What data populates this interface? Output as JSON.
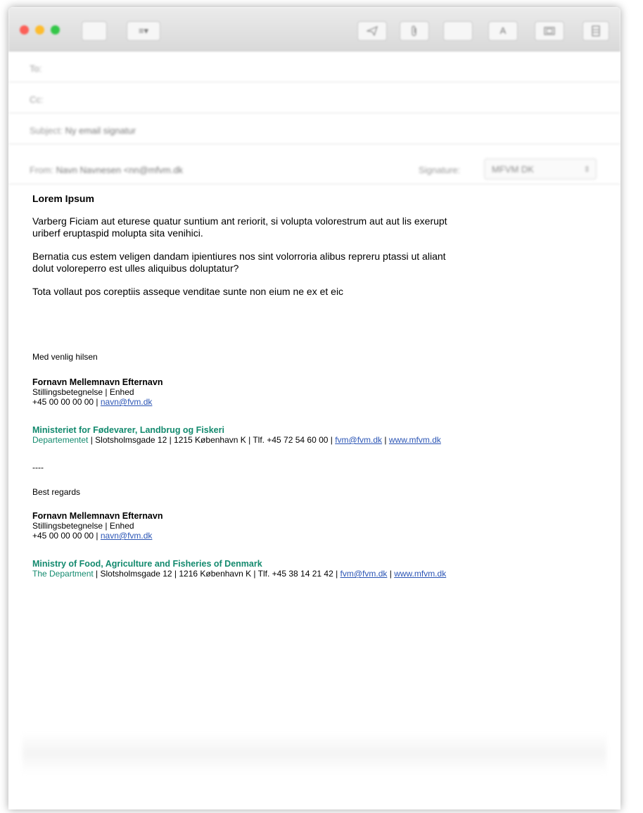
{
  "titlebar": {
    "format_button_label": "≡▾",
    "send_icon": "paper-plane-icon",
    "attach_icon": "paperclip-icon",
    "font_button_label": "A",
    "photo_icon": "photo-browser-icon",
    "sidebar_icon": "sidebar-icon"
  },
  "header": {
    "to_label": "To:",
    "cc_label": "Cc:",
    "subject_label": "Subject:",
    "subject_value": "Ny email signatur",
    "from_label": "From:",
    "from_value": "Navn Navnesen <nn@mfvm.dk",
    "signature_label": "Signature:",
    "signature_value": "MFVM DK"
  },
  "body": {
    "heading": "Lorem Ipsum",
    "paragraphs": [
      "Varberg Ficiam aut eturese quatur suntium ant reriorit, si volupta volorestrum aut aut lis exerupt uriberf eruptaspid molupta sita venihici.",
      "Bernatia cus estem veligen dandam ipientiures nos sint volorroria alibus repreru ptassi ut aliant dolut voloreperro est ulles aliquibus doluptatur?",
      "Tota vollaut pos coreptiis asseque venditae sunte non eium ne ex et eic"
    ]
  },
  "signature_da": {
    "greeting": "Med venlig hilsen",
    "name": "Fornavn Mellemnavn Efternavn",
    "title": "Stillingsbetegnelse | Enhed",
    "phone": "+45 00 00 00 00 | ",
    "email": "navn@fvm.dk",
    "org": "Ministeriet for Fødevarer, Landbrug og Fiskeri",
    "dept": "Departementet",
    "address": " | Slotsholmsgade 12 | 1215 København K | Tlf. +45 72 54 60 00 | ",
    "org_email": "fvm@fvm.dk",
    "sep": " | ",
    "web": "www.mfvm.dk"
  },
  "divider": "----",
  "signature_en": {
    "greeting": "Best regards",
    "name": "Fornavn Mellemnavn Efternavn",
    "title": "Stillingsbetegnelse | Enhed",
    "phone": "+45 00 00 00 00 | ",
    "email": "navn@fvm.dk",
    "org": "Ministry of Food, Agriculture and Fisheries of Denmark",
    "dept": "The Department",
    "address": " | Slotsholmsgade 12 | 1216 København K | Tlf. +45 38 14 21 42 | ",
    "org_email": "fvm@fvm.dk",
    "sep": " | ",
    "web": "www.mfvm.dk"
  },
  "colors": {
    "org_green": "#138a6e",
    "link_blue": "#2b55b5"
  }
}
